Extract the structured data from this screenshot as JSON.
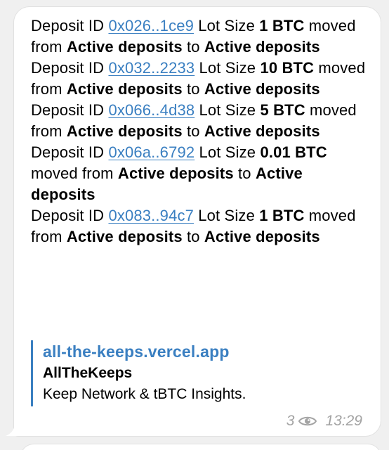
{
  "message": {
    "entries": [
      {
        "prefix": "Deposit ID ",
        "id": "0x026..1ce9",
        "mid": " Lot Size ",
        "size": "1 BTC",
        "moved": " moved from ",
        "from": "Active deposits",
        "to_word": " to ",
        "to": "Active deposits"
      },
      {
        "prefix": " Deposit ID ",
        "id": "0x032..2233",
        "mid": " Lot Size ",
        "size": "10 BTC",
        "moved": " moved from ",
        "from": "Active deposits",
        "to_word": " to ",
        "to": "Active deposits"
      },
      {
        "prefix": " Deposit ID ",
        "id": "0x066..4d38",
        "mid": " Lot Size ",
        "size": "5 BTC",
        "moved": " moved from ",
        "from": "Active deposits",
        "to_word": " to ",
        "to": "Active deposits"
      },
      {
        "prefix": " Deposit ID ",
        "id": "0x06a..6792",
        "mid": " Lot Size ",
        "size": "0.01 BTC",
        "moved": " moved from ",
        "from": "Active deposits",
        "to_word": " to ",
        "to": "Active deposits"
      },
      {
        "prefix": " Deposit ID ",
        "id": "0x083..94c7",
        "mid": " Lot Size ",
        "size": "1 BTC",
        "moved": " moved from ",
        "from": "Active deposits",
        "to_word": " to ",
        "to": "Active deposits"
      }
    ],
    "preview": {
      "site": "all-the-keeps.vercel.app",
      "title": "AllTheKeeps",
      "description": "Keep Network & tBTC Insights."
    },
    "meta": {
      "views": "3",
      "time": "13:29",
      "views_icon": "eye-icon"
    }
  },
  "colors": {
    "link": "#3a7fc1",
    "meta": "#a3a3a3",
    "bubble": "#ffffff",
    "background": "#f0f0f0"
  }
}
